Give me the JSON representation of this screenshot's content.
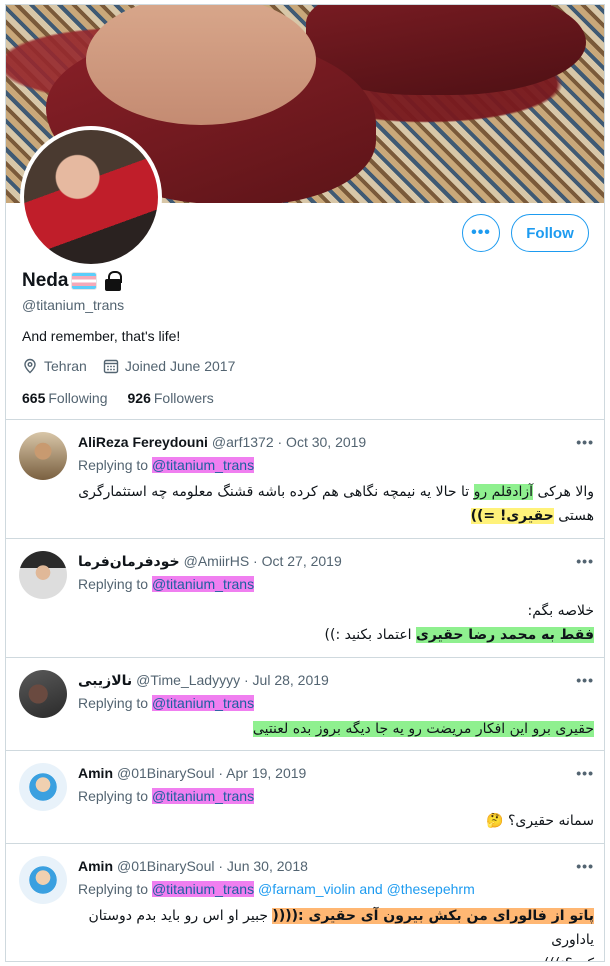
{
  "profile": {
    "name": "Neda",
    "handle": "@titanium_trans",
    "bio": "And remember, that's life!",
    "location": "Tehran",
    "joined": "Joined June 2017",
    "following_count": "665",
    "following_label": "Following",
    "followers_count": "926",
    "followers_label": "Followers",
    "follow_button": "Follow",
    "more_button": "•••"
  },
  "tweets": [
    {
      "name": "AliReza Fereydouni",
      "meta": "@arf1372 · Oct 30, 2019",
      "replying_label": "Replying to",
      "replying_to": "@titanium_trans",
      "body_line1_a": "والا هرکی",
      "body_line1_hl": "آزادقلم رو",
      "body_line1_b": "تا حالا یه نیمچه نگاهی هم کرده باشه قشنگ معلومه چه استثمارگری",
      "body_line2_a": "هستی",
      "body_line2_hl": "حقیری! =))"
    },
    {
      "name": "خودفرمان‌فرما",
      "meta": "@AmiirHS · Oct 27, 2019",
      "replying_label": "Replying to",
      "replying_to": "@titanium_trans",
      "body_line1": "خلاصه بگم:",
      "body_line2_hl": "فقط به محمد رضا حقیری",
      "body_line2_b": "اعتماد بکنید :))"
    },
    {
      "name": "نالازیبی",
      "meta": "@Time_Ladyyyy · Jul 28, 2019",
      "replying_label": "Replying to",
      "replying_to": "@titanium_trans",
      "body_hl": "حقیری برو این افکار مریضت رو یه جا دیگه بروز بده لعنتیی"
    },
    {
      "name": "Amin",
      "meta": "@01BinarySoul · Apr 19, 2019",
      "replying_label": "Replying to",
      "replying_to": "@titanium_trans",
      "body": "سمانه حقیری؟ 🤔"
    },
    {
      "name": "Amin",
      "meta": "@01BinarySoul · Jun 30, 2018",
      "replying_label": "Replying to",
      "replying_to": "@titanium_trans",
      "replying_more": "@farnam_violin and @thesepehrm",
      "body_line1_hl": "پاتو از فالورای من بکش بیرون آی حقیری :((((",
      "body_line1_b": "جبیر او اس رو باید بدم دوستان یاداوری",
      "body_line2": "کنن؟:)))"
    }
  ],
  "colors": {
    "accent": "#1d9bf0",
    "highlight_pink": "#f07ff0",
    "highlight_green": "#8ff08f",
    "highlight_yellow": "#fff27a",
    "highlight_orange": "#ffb773"
  }
}
